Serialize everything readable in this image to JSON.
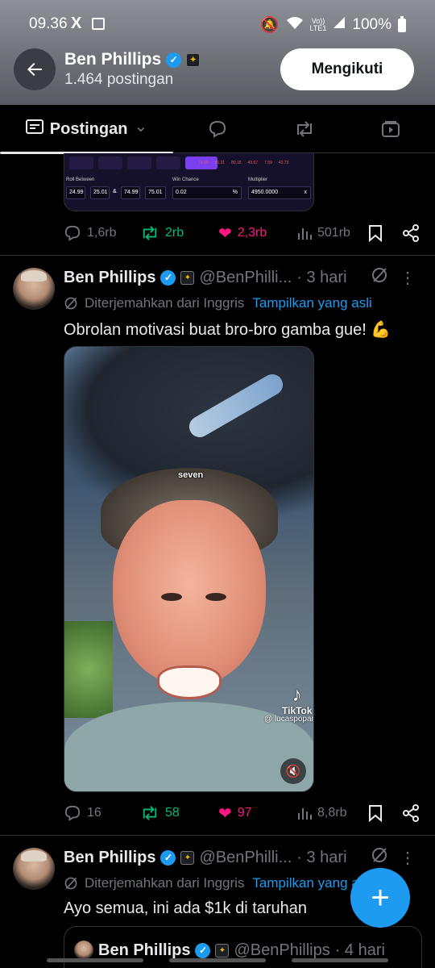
{
  "status_bar": {
    "time": "09.36",
    "x_icon": "X",
    "network_top": "Vo))",
    "network_bottom": "LTE1",
    "battery": "100%"
  },
  "header": {
    "back_icon": "arrow-left-icon",
    "name": "Ben Phillips",
    "post_count": "1.464 postingan",
    "follow_label": "Mengikuti"
  },
  "tabs": {
    "active_label": "Postingan",
    "chevron": "⌄",
    "icons": [
      "reply-icon",
      "repost-icon",
      "video-icon"
    ]
  },
  "top_media": {
    "multipliers": [
      "72.06",
      "85.31",
      "80.15",
      "49.67",
      "7.59",
      "43.73"
    ],
    "roll_between_label": "Roll Between",
    "win_chance_label": "Win Chance",
    "multiplier_label": "Multiplier",
    "range1_low": "24.99",
    "range1_high": "25.01",
    "amp": "&",
    "range2_low": "74.99",
    "range2_high": "75.01",
    "win_chance": "0.02",
    "percent": "%",
    "multiplier": "4950.0000",
    "x": "x"
  },
  "post0_actions": {
    "replies": "1,6rb",
    "reposts": "2rb",
    "likes": "2,3rb",
    "views": "501rb"
  },
  "tweets": [
    {
      "name": "Ben Phillips",
      "handle": "@BenPhilli...",
      "time": "· 3 hari",
      "translated_label": "Diterjemahkan dari Inggris",
      "show_original": "Tampilkan yang asli",
      "text": "Obrolan motivasi buat bro-bro gamba gue! 💪",
      "video": {
        "caption": "seven",
        "tiktok_label": "TikTok",
        "tiktok_handle": "@ lucaspopan"
      },
      "replies": "16",
      "reposts": "58",
      "likes": "97",
      "views": "8,8rb"
    },
    {
      "name": "Ben Phillips",
      "handle": "@BenPhilli...",
      "time": "· 3 hari",
      "translated_label": "Diterjemahkan dari Inggris",
      "show_original": "Tampilkan yang asli",
      "text": "Ayo semua, ini ada $1k di taruhan",
      "quote": {
        "name": "Ben Phillips",
        "handle": "@BenPhillips",
        "time": "· 4 hari"
      }
    }
  ],
  "fab_label": "+",
  "colors": {
    "accent": "#1d9bf0",
    "repost": "#00ba7c",
    "like": "#f91880",
    "muted": "#71767b"
  }
}
